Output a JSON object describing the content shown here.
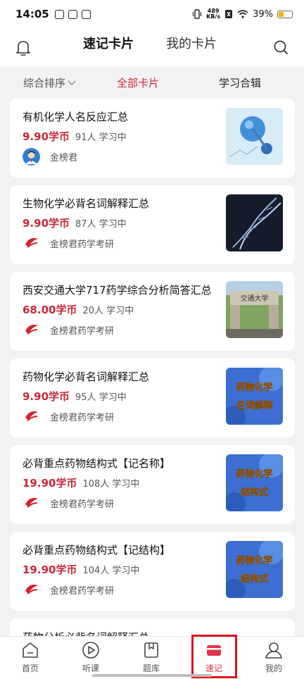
{
  "status_bar": {
    "time": "14:05",
    "net_speed_value": "489",
    "net_speed_unit": "KB/s",
    "battery": "39%"
  },
  "top_nav": {
    "tabs": [
      {
        "label": "速记卡片",
        "active": true
      },
      {
        "label": "我的卡片",
        "active": false
      }
    ]
  },
  "filter": {
    "sort": "综合排序",
    "all": "全部卡片",
    "collection": "学习合辑"
  },
  "colors": {
    "accent": "#d0283a",
    "highlight": "#e0141f"
  },
  "cards": [
    {
      "title": "有机化学人名反应汇总",
      "price": "9.90学币",
      "learners": "91人 学习中",
      "author": "金榜君",
      "thumb_text": [
        "",
        ""
      ],
      "thumb_icon": "molecule-image"
    },
    {
      "title": "生物化学必背名词解释汇总",
      "price": "9.90学币",
      "learners": "87人 学习中",
      "author": "金榜君药学考研",
      "thumb_text": [
        "",
        ""
      ],
      "thumb_icon": "dna-image"
    },
    {
      "title": "西安交通大学717药学综合分析简答汇总",
      "price": "68.00学币",
      "learners": "20人 学习中",
      "author": "金榜君药学考研",
      "thumb_text": [
        "交通大学",
        ""
      ],
      "thumb_icon": "university-gate-image"
    },
    {
      "title": "药物化学必背名词解释汇总",
      "price": "9.90学币",
      "learners": "95人 学习中",
      "author": "金榜君药学考研",
      "thumb_text": [
        "药物化学",
        "名词解释"
      ],
      "thumb_icon": "cover-image"
    },
    {
      "title": "必背重点药物结构式【记名称】",
      "price": "19.90学币",
      "learners": "108人 学习中",
      "author": "金榜君药学考研",
      "thumb_text": [
        "药物化学",
        "结构式"
      ],
      "thumb_icon": "cover-image"
    },
    {
      "title": "必背重点药物结构式【记结构】",
      "price": "19.90学币",
      "learners": "104人 学习中",
      "author": "金榜君药学考研",
      "thumb_text": [
        "药物化学",
        "结构式"
      ],
      "thumb_icon": "cover-image"
    }
  ],
  "partial_card": {
    "title": "药物分析必背名词解释汇总"
  },
  "bottom_nav": [
    {
      "label": "首页",
      "icon": "home-icon"
    },
    {
      "label": "听课",
      "icon": "play-icon"
    },
    {
      "label": "题库",
      "icon": "bookmark-book-icon"
    },
    {
      "label": "速记",
      "icon": "card-icon",
      "active": true
    },
    {
      "label": "我的",
      "icon": "user-icon"
    }
  ]
}
